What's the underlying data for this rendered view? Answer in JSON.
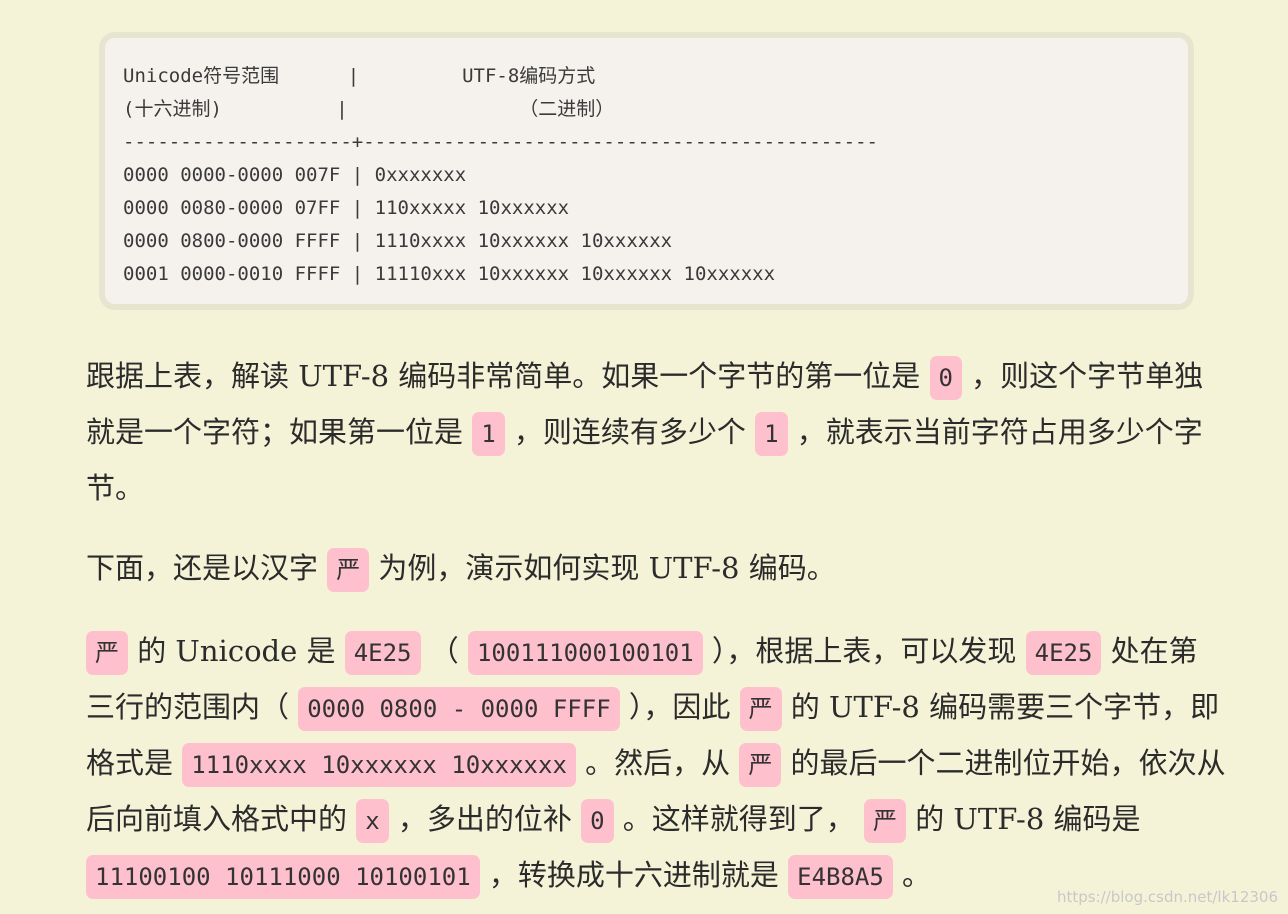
{
  "code_block": {
    "lines": [
      "Unicode符号范围      |         UTF-8编码方式",
      "(十六进制)          |               （二进制）",
      "--------------------+---------------------------------------------",
      "0000 0000-0000 007F | 0xxxxxxx",
      "0000 0080-0000 07FF | 110xxxxx 10xxxxxx",
      "0000 0800-0000 FFFF | 1110xxxx 10xxxxxx 10xxxxxx",
      "0001 0000-0010 FFFF | 11110xxx 10xxxxxx 10xxxxxx 10xxxxxx"
    ]
  },
  "paragraph1": {
    "t1": "跟据上表，解读 UTF-8 编码非常简单。如果一个字节的第一位是 ",
    "c1": "0",
    "t2": " ，则这个字节单独就是一个字符；如果第一位是 ",
    "c2": "1",
    "t3": " ，则连续有多少个 ",
    "c3": "1",
    "t4": " ，就表示当前字符占用多少个字节。"
  },
  "paragraph2": {
    "t1": "下面，还是以汉字 ",
    "c1": "严",
    "t2": " 为例，演示如何实现 UTF-8 编码。"
  },
  "paragraph3": {
    "c1": "严",
    "t1": " 的 Unicode 是 ",
    "c2": "4E25",
    "t2": " （ ",
    "c3": "100111000100101",
    "t3": " ），根据上表，可以发现 ",
    "c4": "4E25",
    "t4": " 处在第三行的范围内（ ",
    "c5": "0000 0800 - 0000 FFFF",
    "t5": " ），因此 ",
    "c6": "严",
    "t6": " 的 UTF-8 编码需要三个字节，即格式是 ",
    "c7": "1110xxxx 10xxxxxx 10xxxxxx",
    "t7": " 。然后，从 ",
    "c8": "严",
    "t8": " 的最后一个二进制位开始，依次从后向前填入格式中的 ",
    "c9": "x",
    "t9": " ，多出的位补 ",
    "c10": "0",
    "t10": " 。这样就得到了， ",
    "c11": "严",
    "t11": " 的 UTF-8 编码是 ",
    "c12": "11100100 10111000 10100101",
    "t12": " ，转换成十六进制就是 ",
    "c13": "E4B8A5",
    "t13": " 。"
  },
  "watermark": "https://blog.csdn.net/lk12306"
}
